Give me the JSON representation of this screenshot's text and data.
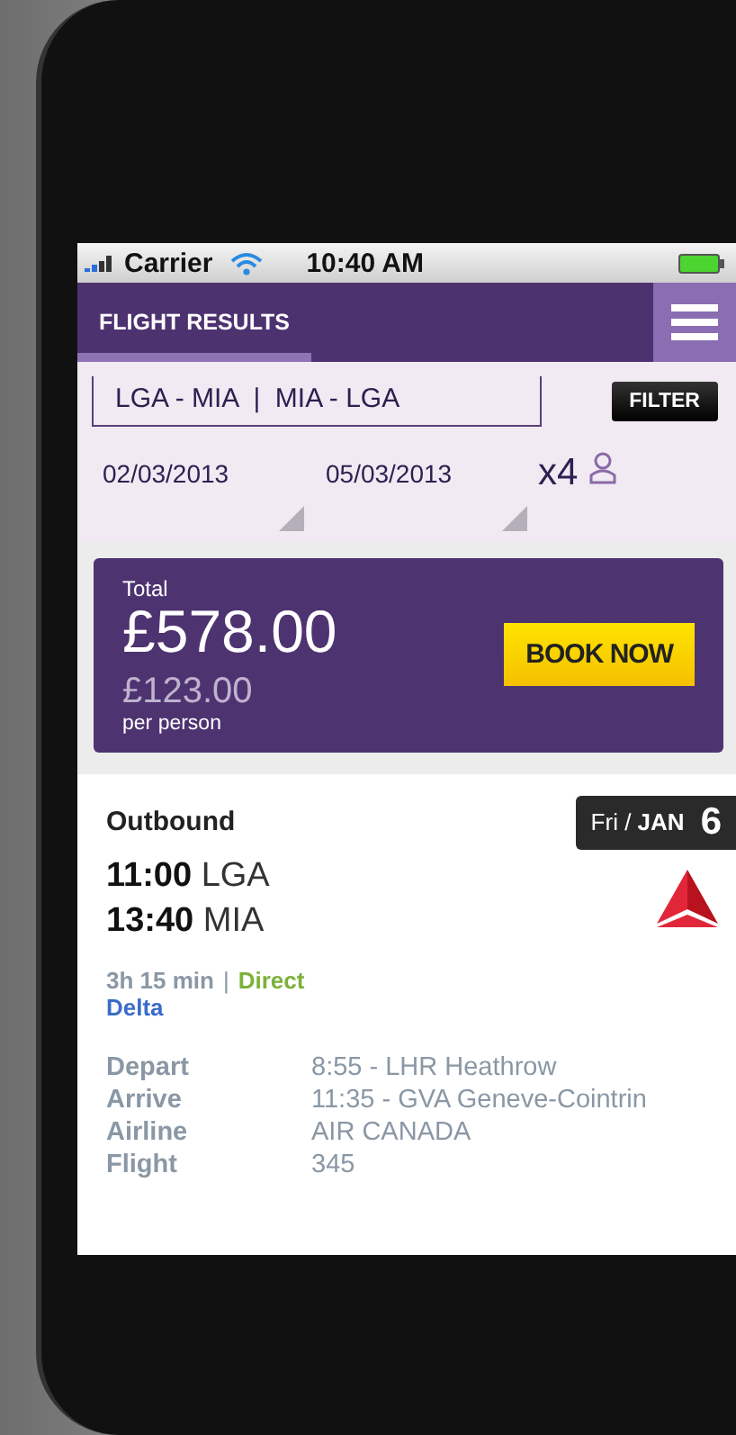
{
  "status_bar": {
    "carrier": "Carrier",
    "time": "10:40 AM"
  },
  "header": {
    "tabs": [
      {
        "label": "FLIGHT RESULTS",
        "selected": true
      }
    ]
  },
  "search": {
    "route": "LGA - MIA  |  MIA - LGA",
    "filter_button": "FILTER",
    "depart_date": "02/03/2013",
    "return_date": "05/03/2013",
    "passengers": "x4"
  },
  "price": {
    "total_label": "Total",
    "total": "£578.00",
    "per_person_price": "£123.00",
    "per_person_label": "per person",
    "book_button": "BOOK NOW"
  },
  "flight": {
    "direction": "Outbound",
    "date": "Fri / **JAN**",
    "date_number": "6",
    "departure_time": "11:00",
    "departure_airport": "LGA",
    "arrival_time": "13:40",
    "arrival_airport": "MIA",
    "duration": "3h 15 min",
    "separator": "|",
    "stops": "Direct",
    "airline": "Delta",
    "details": [
      {
        "label": "Depart",
        "value": "8:55 - LHR Heathrow"
      },
      {
        "label": "Arrive",
        "value": "11:35 - GVA Geneve-Cointrin"
      },
      {
        "label": "Airline",
        "value": "AIR CANADA"
      },
      {
        "label": "Flight",
        "value": "345"
      }
    ]
  }
}
